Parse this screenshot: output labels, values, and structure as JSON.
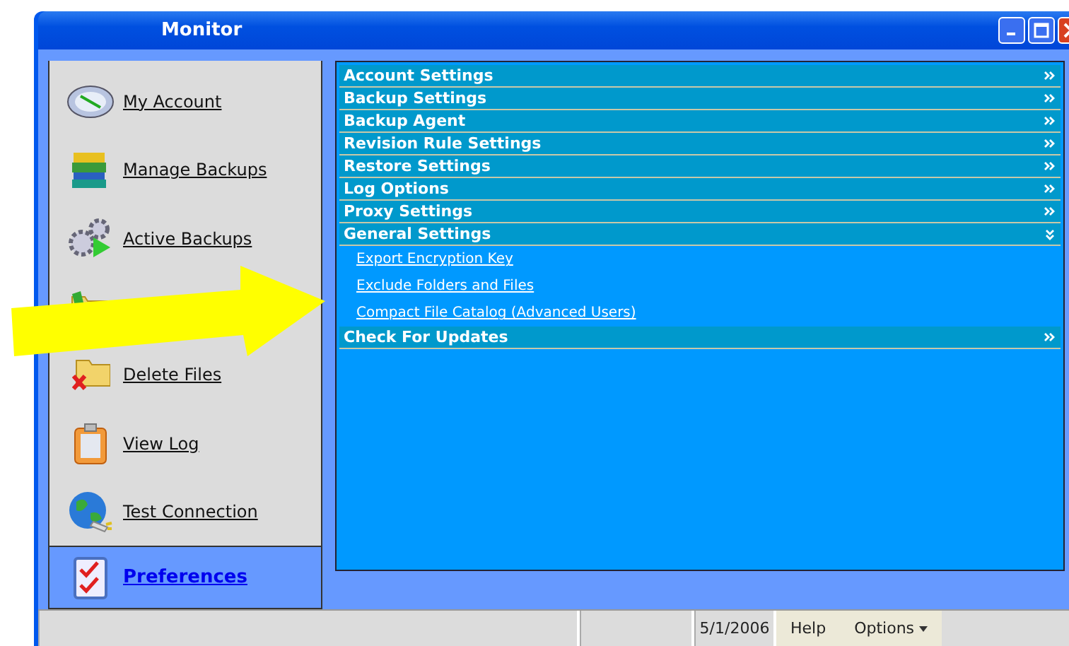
{
  "window": {
    "title": "Monitor"
  },
  "sidebar": {
    "items": [
      {
        "label": "My Account",
        "selected": false
      },
      {
        "label": "Manage Backups",
        "selected": false
      },
      {
        "label": "Active Backups",
        "selected": false
      },
      {
        "selected": false
      },
      {
        "label": "Delete Files",
        "selected": false
      },
      {
        "label": "View Log",
        "selected": false
      },
      {
        "label": "Test Connection",
        "selected": false
      },
      {
        "label": "Preferences",
        "selected": true
      }
    ]
  },
  "sections": [
    {
      "title": "Account Settings",
      "expanded": false
    },
    {
      "title": "Backup Settings",
      "expanded": false
    },
    {
      "title": "Backup Agent",
      "expanded": false
    },
    {
      "title": "Revision Rule Settings",
      "expanded": false
    },
    {
      "title": "Restore Settings",
      "expanded": false
    },
    {
      "title": "Log Options",
      "expanded": false
    },
    {
      "title": "Proxy Settings",
      "expanded": false
    },
    {
      "title": "General Settings",
      "expanded": true,
      "links": [
        "Export Encryption Key",
        "Exclude Folders and Files",
        "Compact File Catalog (Advanced Users)"
      ]
    },
    {
      "title": "Check For Updates",
      "expanded": false
    }
  ],
  "status_bar": {
    "date": "5/1/2006",
    "help": "Help",
    "options": "Options"
  }
}
